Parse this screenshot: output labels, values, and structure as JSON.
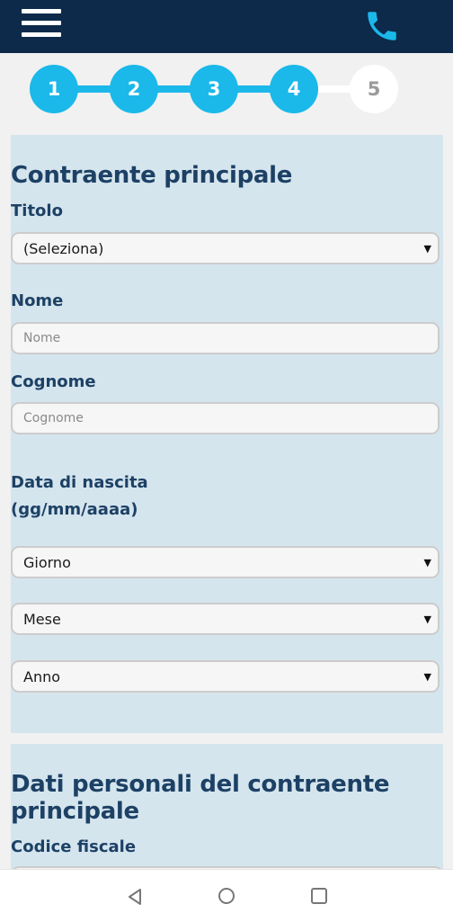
{
  "header": {
    "menu_icon": "hamburger-menu-icon",
    "phone_icon": "phone-icon"
  },
  "steps": [
    {
      "label": "1",
      "state": "completed"
    },
    {
      "label": "2",
      "state": "completed"
    },
    {
      "label": "3",
      "state": "completed"
    },
    {
      "label": "4",
      "state": "current"
    },
    {
      "label": "5",
      "state": "upcoming"
    }
  ],
  "section1": {
    "title": "Contraente principale",
    "titolo_label": "Titolo",
    "titolo_value": "(Seleziona)",
    "nome_label": "Nome",
    "nome_placeholder": "Nome",
    "cognome_label": "Cognome",
    "cognome_placeholder": "Cognome",
    "dob_label_line1": "Data di nascita",
    "dob_label_line2": "(gg/mm/aaaa)",
    "giorno_value": "Giorno",
    "mese_value": "Mese",
    "anno_value": "Anno"
  },
  "section2": {
    "title_line1": "Dati personali del contraente",
    "title_line2": "principale",
    "codice_fiscale_label": "Codice fiscale"
  },
  "system_nav": {
    "back_icon": "back-triangle-icon",
    "home_icon": "home-circle-icon",
    "recents_icon": "recents-square-icon"
  },
  "colors": {
    "header_bg": "#0d2a4a",
    "accent": "#1bb8ea",
    "panel_bg": "#d5e5ee",
    "heading_text": "#1d4165"
  }
}
